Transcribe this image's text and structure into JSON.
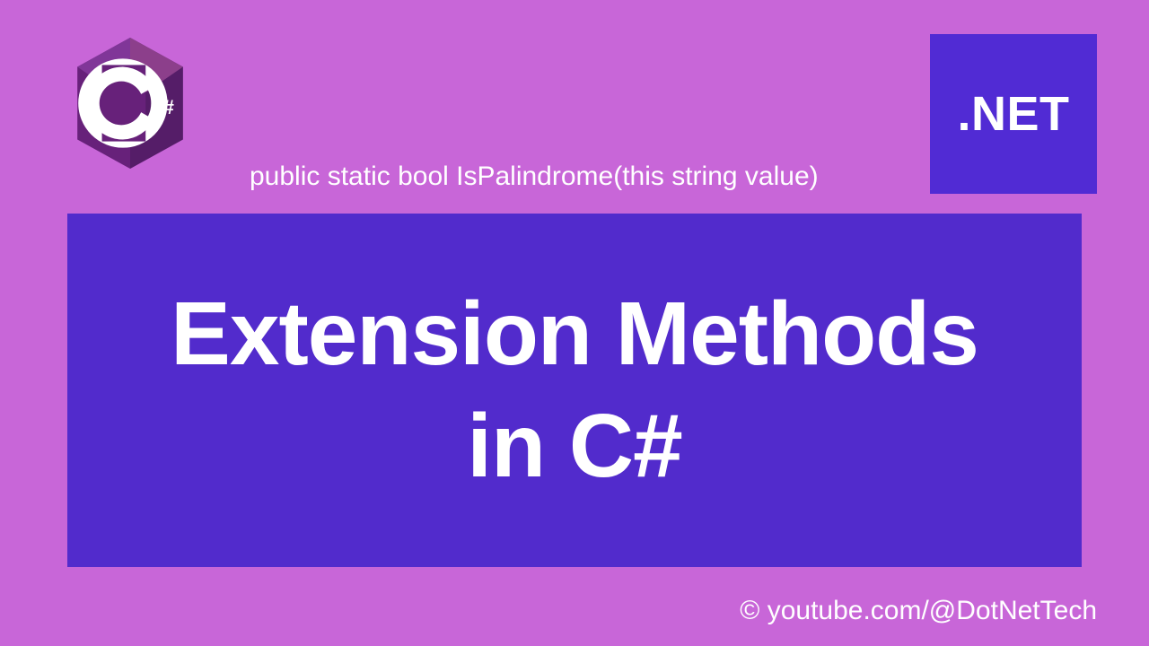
{
  "logos": {
    "csharp_label": "C#",
    "dotnet_label": ".NET"
  },
  "code_snippet": "public static bool IsPalindrome(this string value)",
  "title": {
    "line1": "Extension Methods",
    "line2": "in C#"
  },
  "attribution": "© youtube.com/@DotNetTech",
  "colors": {
    "background": "#c866d8",
    "accent": "#522bcc",
    "dotnet_bg": "#512bd4",
    "text": "#ffffff"
  }
}
